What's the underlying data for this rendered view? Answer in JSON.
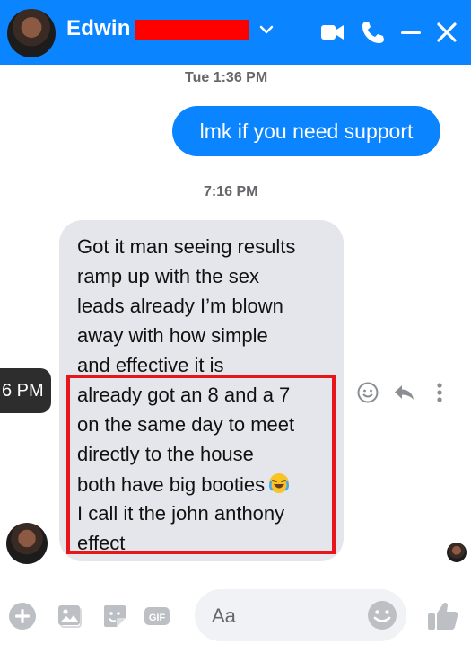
{
  "header": {
    "contact_name": "Edwin",
    "icons": [
      "avatar",
      "chevron-down-icon",
      "video-call-icon",
      "phone-icon",
      "minimize-icon",
      "close-icon"
    ]
  },
  "conversation": {
    "timestamp_1": "Tue 1:36 PM",
    "outgoing_message": "lmk if you need support",
    "timestamp_2": "7:16 PM",
    "incoming_lines": [
      "Got it man seeing results",
      "ramp up with the sex",
      "leads already I’m blown",
      "away with how simple",
      "and effective it is",
      "already got an 8 and a 7",
      "on the same day to meet",
      "directly to the house",
      "both have big booties",
      "I call it the john anthony",
      "effect"
    ],
    "hover_time_fragment": "6 PM"
  },
  "composer": {
    "placeholder": "Aa",
    "icons": [
      "plus-icon",
      "photo-icon",
      "sticker-icon",
      "gif-icon",
      "emoji-icon",
      "thumbs-up-icon"
    ]
  },
  "colors": {
    "accent": "#0a84ff",
    "incoming_bubble": "#e4e6eb",
    "highlight_border": "#e8151b"
  }
}
